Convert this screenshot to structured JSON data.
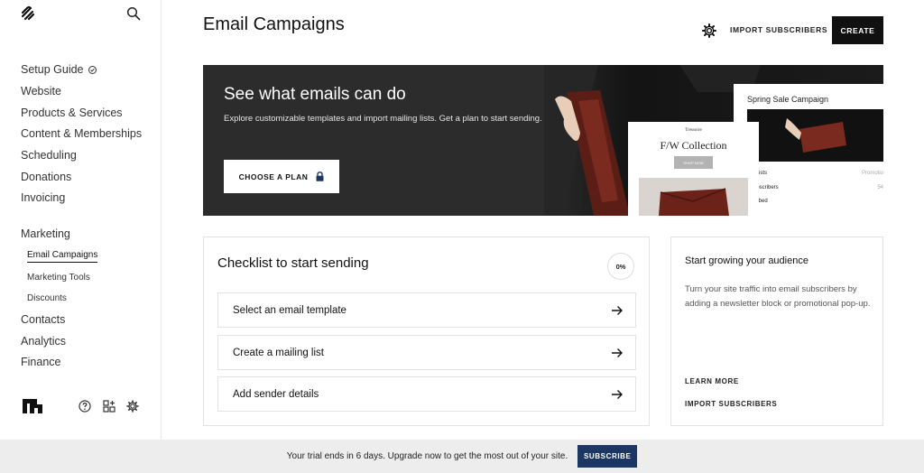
{
  "sidebar": {
    "logo_icon": "squarespace-logo-icon",
    "search_icon": "search-icon",
    "items": [
      {
        "label": "Setup Guide",
        "icon": "sparkle-check-icon"
      },
      {
        "label": "Website"
      },
      {
        "label": "Products & Services"
      },
      {
        "label": "Content & Memberships"
      },
      {
        "label": "Scheduling"
      },
      {
        "label": "Donations"
      },
      {
        "label": "Invoicing"
      }
    ],
    "marketing": {
      "label": "Marketing",
      "subitems": [
        {
          "label": "Email Campaigns",
          "active": true
        },
        {
          "label": "Marketing Tools"
        },
        {
          "label": "Discounts"
        }
      ]
    },
    "items_after": [
      {
        "label": "Contacts"
      },
      {
        "label": "Analytics"
      },
      {
        "label": "Finance"
      }
    ],
    "bottom_icons": [
      "brand-mark-icon",
      "help-icon",
      "apps-grid-icon",
      "settings-gear-icon"
    ]
  },
  "header": {
    "title": "Email Campaigns",
    "settings_icon": "gear-icon",
    "import_label": "IMPORT SUBSCRIBERS",
    "create_label": "CREATE"
  },
  "hero": {
    "title": "See what emails can do",
    "description": "Explore customizable templates and import mailing lists. Get a plan to start sending.",
    "button_label": "CHOOSE A PLAN",
    "button_icon": "lock-icon",
    "preview_card_1": {
      "brand": "Tressoire",
      "title": "F/W Collection",
      "button": "SHOP NOW"
    },
    "preview_card_2": {
      "title": "Spring Sale Campaign",
      "rows": [
        {
          "label": "ing Lists",
          "value": "Promotio"
        },
        {
          "label": "l Subscribers",
          "value": "54"
        },
        {
          "label": "bscribed",
          "value": ""
        }
      ]
    }
  },
  "checklist": {
    "title": "Checklist to start sending",
    "progress": "0%",
    "tasks": [
      {
        "label": "Select an email template"
      },
      {
        "label": "Create a mailing list"
      },
      {
        "label": "Add sender details"
      }
    ]
  },
  "audience": {
    "title": "Start growing your audience",
    "description": "Turn your site traffic into email subscribers by adding a newsletter block or promotional pop-up.",
    "learn_more": "LEARN MORE",
    "import_label": "IMPORT SUBSCRIBERS"
  },
  "trial_bar": {
    "message": "Your trial ends in 6 days. Upgrade now to get the most out of your site.",
    "button_label": "SUBSCRIBE",
    "button_color": "#1c3763"
  }
}
